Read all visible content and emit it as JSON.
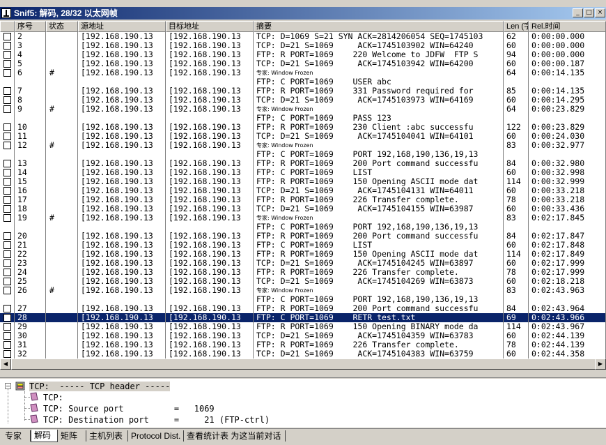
{
  "window": {
    "title": "Snif5: 解码, 28/32 以太网帧",
    "btn_min": "_",
    "btn_max": "□",
    "btn_close": "×"
  },
  "columns": [
    "",
    "序号",
    "状态",
    "源地址",
    "目标地址",
    "摘要",
    "Len (字",
    "Rel.时间"
  ],
  "rows": [
    {
      "num": "2",
      "st": "",
      "src": "[192.168.190.13",
      "dst": "[192.168.190.13",
      "sum": "TCP: D=1069 S=21 SYN ACK=2814206054 SEQ=1745103",
      "len": "62",
      "rel": "0:00:00.000",
      "chk": true,
      "ex": false,
      "sel": false
    },
    {
      "num": "3",
      "st": "",
      "src": "[192.168.190.13",
      "dst": "[192.168.190.13",
      "sum": "TCP: D=21 S=1069     ACK=1745103902 WIN=64240",
      "len": "60",
      "rel": "0:00:00.000",
      "chk": true,
      "ex": false,
      "sel": false
    },
    {
      "num": "4",
      "st": "",
      "src": "[192.168.190.13",
      "dst": "[192.168.190.13",
      "sum": "FTP: R PORT=1069    220 Welcome to JDFW  FTP S",
      "len": "94",
      "rel": "0:00:00.000",
      "chk": true,
      "ex": false,
      "sel": false
    },
    {
      "num": "5",
      "st": "",
      "src": "[192.168.190.13",
      "dst": "[192.168.190.13",
      "sum": "TCP: D=21 S=1069     ACK=1745103942 WIN=64200",
      "len": "60",
      "rel": "0:00:00.187",
      "chk": true,
      "ex": false,
      "sel": false
    },
    {
      "num": "6",
      "st": "#",
      "src": "[192.168.190.13",
      "dst": "[192.168.190.13",
      "sum": "专家: Window Frozen",
      "len": "64",
      "rel": "0:00:14.135",
      "chk": true,
      "ex": true,
      "sel": false
    },
    {
      "num": "",
      "st": "",
      "src": "",
      "dst": "",
      "sum": "FTP: C PORT=1069    USER abc",
      "len": "",
      "rel": "",
      "chk": false,
      "ex": false,
      "sel": false
    },
    {
      "num": "7",
      "st": "",
      "src": "[192.168.190.13",
      "dst": "[192.168.190.13",
      "sum": "FTP: R PORT=1069    331 Password required for",
      "len": "85",
      "rel": "0:00:14.135",
      "chk": true,
      "ex": false,
      "sel": false
    },
    {
      "num": "8",
      "st": "",
      "src": "[192.168.190.13",
      "dst": "[192.168.190.13",
      "sum": "TCP: D=21 S=1069     ACK=1745103973 WIN=64169",
      "len": "60",
      "rel": "0:00:14.295",
      "chk": true,
      "ex": false,
      "sel": false
    },
    {
      "num": "9",
      "st": "#",
      "src": "[192.168.190.13",
      "dst": "[192.168.190.13",
      "sum": "专家: Window Frozen",
      "len": "64",
      "rel": "0:00:23.829",
      "chk": true,
      "ex": true,
      "sel": false
    },
    {
      "num": "",
      "st": "",
      "src": "",
      "dst": "",
      "sum": "FTP: C PORT=1069    PASS 123",
      "len": "",
      "rel": "",
      "chk": false,
      "ex": false,
      "sel": false
    },
    {
      "num": "10",
      "st": "",
      "src": "[192.168.190.13",
      "dst": "[192.168.190.13",
      "sum": "FTP: R PORT=1069    230 Client :abc successfu",
      "len": "122",
      "rel": "0:00:23.829",
      "chk": true,
      "ex": false,
      "sel": false
    },
    {
      "num": "11",
      "st": "",
      "src": "[192.168.190.13",
      "dst": "[192.168.190.13",
      "sum": "TCP: D=21 S=1069     ACK=1745104041 WIN=64101",
      "len": "60",
      "rel": "0:00:24.030",
      "chk": true,
      "ex": false,
      "sel": false
    },
    {
      "num": "12",
      "st": "#",
      "src": "[192.168.190.13",
      "dst": "[192.168.190.13",
      "sum": "专家: Window Frozen",
      "len": "83",
      "rel": "0:00:32.977",
      "chk": true,
      "ex": true,
      "sel": false
    },
    {
      "num": "",
      "st": "",
      "src": "",
      "dst": "",
      "sum": "FTP: C PORT=1069    PORT 192,168,190,136,19,13",
      "len": "",
      "rel": "",
      "chk": false,
      "ex": false,
      "sel": false
    },
    {
      "num": "13",
      "st": "",
      "src": "[192.168.190.13",
      "dst": "[192.168.190.13",
      "sum": "FTP: R PORT=1069    200 Port command successfu",
      "len": "84",
      "rel": "0:00:32.980",
      "chk": true,
      "ex": false,
      "sel": false
    },
    {
      "num": "14",
      "st": "",
      "src": "[192.168.190.13",
      "dst": "[192.168.190.13",
      "sum": "FTP: C PORT=1069    LIST",
      "len": "60",
      "rel": "0:00:32.998",
      "chk": true,
      "ex": false,
      "sel": false
    },
    {
      "num": "15",
      "st": "",
      "src": "[192.168.190.13",
      "dst": "[192.168.190.13",
      "sum": "FTP: R PORT=1069    150 Opening ASCII mode dat",
      "len": "114",
      "rel": "0:00:32.999",
      "chk": true,
      "ex": false,
      "sel": false
    },
    {
      "num": "16",
      "st": "",
      "src": "[192.168.190.13",
      "dst": "[192.168.190.13",
      "sum": "TCP: D=21 S=1069     ACK=1745104131 WIN=64011",
      "len": "60",
      "rel": "0:00:33.218",
      "chk": true,
      "ex": false,
      "sel": false
    },
    {
      "num": "17",
      "st": "",
      "src": "[192.168.190.13",
      "dst": "[192.168.190.13",
      "sum": "FTP: R PORT=1069    226 Transfer complete.",
      "len": "78",
      "rel": "0:00:33.218",
      "chk": true,
      "ex": false,
      "sel": false
    },
    {
      "num": "18",
      "st": "",
      "src": "[192.168.190.13",
      "dst": "[192.168.190.13",
      "sum": "TCP: D=21 S=1069     ACK=1745104155 WIN=63987",
      "len": "60",
      "rel": "0:00:33.436",
      "chk": true,
      "ex": false,
      "sel": false
    },
    {
      "num": "19",
      "st": "#",
      "src": "[192.168.190.13",
      "dst": "[192.168.190.13",
      "sum": "专家: Window Frozen",
      "len": "83",
      "rel": "0:02:17.845",
      "chk": true,
      "ex": true,
      "sel": false
    },
    {
      "num": "",
      "st": "",
      "src": "",
      "dst": "",
      "sum": "FTP: C PORT=1069    PORT 192,168,190,136,19,13",
      "len": "",
      "rel": "",
      "chk": false,
      "ex": false,
      "sel": false
    },
    {
      "num": "20",
      "st": "",
      "src": "[192.168.190.13",
      "dst": "[192.168.190.13",
      "sum": "FTP: R PORT=1069    200 Port command successfu",
      "len": "84",
      "rel": "0:02:17.847",
      "chk": true,
      "ex": false,
      "sel": false
    },
    {
      "num": "21",
      "st": "",
      "src": "[192.168.190.13",
      "dst": "[192.168.190.13",
      "sum": "FTP: C PORT=1069    LIST",
      "len": "60",
      "rel": "0:02:17.848",
      "chk": true,
      "ex": false,
      "sel": false
    },
    {
      "num": "22",
      "st": "",
      "src": "[192.168.190.13",
      "dst": "[192.168.190.13",
      "sum": "FTP: R PORT=1069    150 Opening ASCII mode dat",
      "len": "114",
      "rel": "0:02:17.849",
      "chk": true,
      "ex": false,
      "sel": false
    },
    {
      "num": "23",
      "st": "",
      "src": "[192.168.190.13",
      "dst": "[192.168.190.13",
      "sum": "TCP: D=21 S=1069     ACK=1745104245 WIN=63897",
      "len": "60",
      "rel": "0:02:17.999",
      "chk": true,
      "ex": false,
      "sel": false
    },
    {
      "num": "24",
      "st": "",
      "src": "[192.168.190.13",
      "dst": "[192.168.190.13",
      "sum": "FTP: R PORT=1069    226 Transfer complete.",
      "len": "78",
      "rel": "0:02:17.999",
      "chk": true,
      "ex": false,
      "sel": false
    },
    {
      "num": "25",
      "st": "",
      "src": "[192.168.190.13",
      "dst": "[192.168.190.13",
      "sum": "TCP: D=21 S=1069     ACK=1745104269 WIN=63873",
      "len": "60",
      "rel": "0:02:18.218",
      "chk": true,
      "ex": false,
      "sel": false
    },
    {
      "num": "26",
      "st": "#",
      "src": "[192.168.190.13",
      "dst": "[192.168.190.13",
      "sum": "专家: Window Frozen",
      "len": "83",
      "rel": "0:02:43.963",
      "chk": true,
      "ex": true,
      "sel": false
    },
    {
      "num": "",
      "st": "",
      "src": "",
      "dst": "",
      "sum": "FTP: C PORT=1069    PORT 192,168,190,136,19,13",
      "len": "",
      "rel": "",
      "chk": false,
      "ex": false,
      "sel": false
    },
    {
      "num": "27",
      "st": "",
      "src": "[192.168.190.13",
      "dst": "[192.168.190.13",
      "sum": "FTP: R PORT=1069    200 Port command successfu",
      "len": "84",
      "rel": "0:02:43.964",
      "chk": true,
      "ex": false,
      "sel": false
    },
    {
      "num": "28",
      "st": "",
      "src": "[192.168.190.13",
      "dst": "[192.168.190.13",
      "sum": "FTP: C PORT=1069    RETR test.txt",
      "len": "69",
      "rel": "0:02:43.966",
      "chk": true,
      "ex": false,
      "sel": true
    },
    {
      "num": "29",
      "st": "",
      "src": "[192.168.190.13",
      "dst": "[192.168.190.13",
      "sum": "FTP: R PORT=1069    150 Opening BINARY mode da",
      "len": "114",
      "rel": "0:02:43.967",
      "chk": true,
      "ex": false,
      "sel": false
    },
    {
      "num": "30",
      "st": "",
      "src": "[192.168.190.13",
      "dst": "[192.168.190.13",
      "sum": "TCP: D=21 S=1069     ACK=1745104359 WIN=63783",
      "len": "60",
      "rel": "0:02:44.139",
      "chk": true,
      "ex": false,
      "sel": false
    },
    {
      "num": "31",
      "st": "",
      "src": "[192.168.190.13",
      "dst": "[192.168.190.13",
      "sum": "FTP: R PORT=1069    226 Transfer complete.",
      "len": "78",
      "rel": "0:02:44.139",
      "chk": true,
      "ex": false,
      "sel": false
    },
    {
      "num": "32",
      "st": "",
      "src": "[192.168.190.13",
      "dst": "[192.168.190.13",
      "sum": "TCP: D=21 S=1069     ACK=1745104383 WIN=63759",
      "len": "60",
      "rel": "0:02:44.358",
      "chk": true,
      "ex": false,
      "sel": false
    }
  ],
  "tree": {
    "root": "TCP:  ----- TCP header -----",
    "items": [
      "TCP:",
      "TCP: Source port          =   1069",
      "TCP: Destination port     =     21 (FTP-ctrl)"
    ]
  },
  "tabs": [
    "专家",
    "解码",
    "矩阵",
    "主机列表",
    "Protocol Dist.",
    "查看统计表 为这当前对话"
  ],
  "active_tab": "解码",
  "colors": {
    "selection": "#0a246a",
    "title_start": "#0a246a",
    "title_end": "#a6caf0"
  }
}
